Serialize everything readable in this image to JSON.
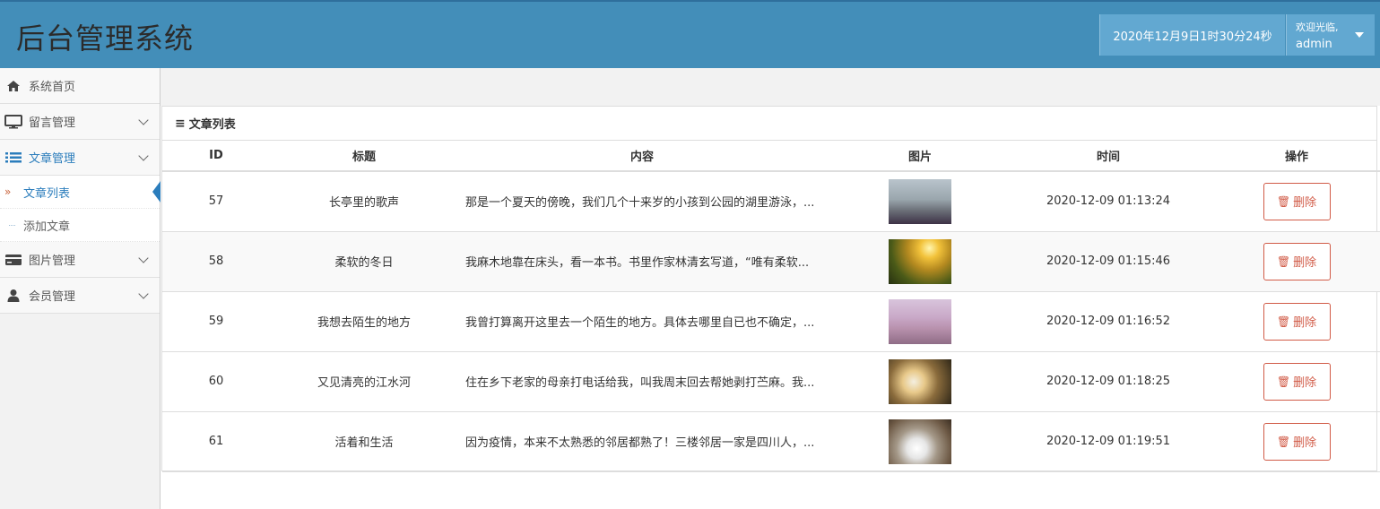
{
  "header": {
    "title": "后台管理系统",
    "datetime": "2020年12月9日1时30分24秒",
    "welcome": "欢迎光临,",
    "username": "admin"
  },
  "sidebar": {
    "items": [
      {
        "label": "系统首页",
        "icon": "home-icon"
      },
      {
        "label": "留言管理",
        "icon": "desktop-icon"
      },
      {
        "label": "文章管理",
        "icon": "list-icon"
      },
      {
        "label": "图片管理",
        "icon": "credit-card-icon"
      },
      {
        "label": "会员管理",
        "icon": "user-icon"
      }
    ],
    "sub_items": [
      {
        "label": "文章列表"
      },
      {
        "label": "添加文章"
      }
    ]
  },
  "panel": {
    "title": "文章列表",
    "columns": [
      "ID",
      "标题",
      "内容",
      "图片",
      "时间",
      "操作"
    ],
    "delete_label": "删除",
    "rows": [
      {
        "id": "57",
        "title": "长亭里的歌声",
        "content": "那是一个夏天的傍晚，我们几个十来岁的小孩到公园的湖里游泳，...",
        "time": "2020-12-09 01:13:24"
      },
      {
        "id": "58",
        "title": "柔软的冬日",
        "content": "我麻木地靠在床头，看一本书。书里作家林清玄写道，“唯有柔软...",
        "time": "2020-12-09 01:15:46"
      },
      {
        "id": "59",
        "title": "我想去陌生的地方",
        "content": "我曾打算离开这里去一个陌生的地方。具体去哪里自已也不确定，...",
        "time": "2020-12-09 01:16:52"
      },
      {
        "id": "60",
        "title": "又见清亮的江水河",
        "content": "住在乡下老家的母亲打电话给我，叫我周末回去帮她剥打苎麻。我...",
        "time": "2020-12-09 01:18:25"
      },
      {
        "id": "61",
        "title": "活着和生活",
        "content": "因为疫情，本来不太熟悉的邻居都熟了！三楼邻居一家是四川人，...",
        "time": "2020-12-09 01:19:51"
      }
    ]
  },
  "colors": {
    "header_bg": "#438eb9",
    "header_box": "#62a8d1",
    "accent": "#2b7dbc",
    "danger": "#d15b47"
  }
}
